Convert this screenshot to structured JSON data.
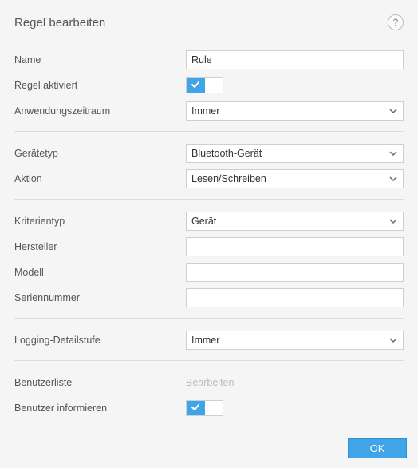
{
  "header": {
    "title": "Regel bearbeiten"
  },
  "labels": {
    "name": "Name",
    "ruleActive": "Regel aktiviert",
    "period": "Anwendungszeitraum",
    "deviceType": "Gerätetyp",
    "action": "Aktion",
    "criteriaType": "Kriterientyp",
    "manufacturer": "Hersteller",
    "model": "Modell",
    "serial": "Seriennummer",
    "logging": "Logging-Detailstufe",
    "userList": "Benutzerliste",
    "notifyUser": "Benutzer informieren"
  },
  "values": {
    "name": "Rule",
    "ruleActive": true,
    "period": "Immer",
    "deviceType": "Bluetooth-Gerät",
    "action": "Lesen/Schreiben",
    "criteriaType": "Gerät",
    "manufacturer": "",
    "model": "",
    "serial": "",
    "logging": "Immer",
    "userListLink": "Bearbeiten",
    "notifyUser": true
  },
  "footer": {
    "ok": "OK"
  }
}
